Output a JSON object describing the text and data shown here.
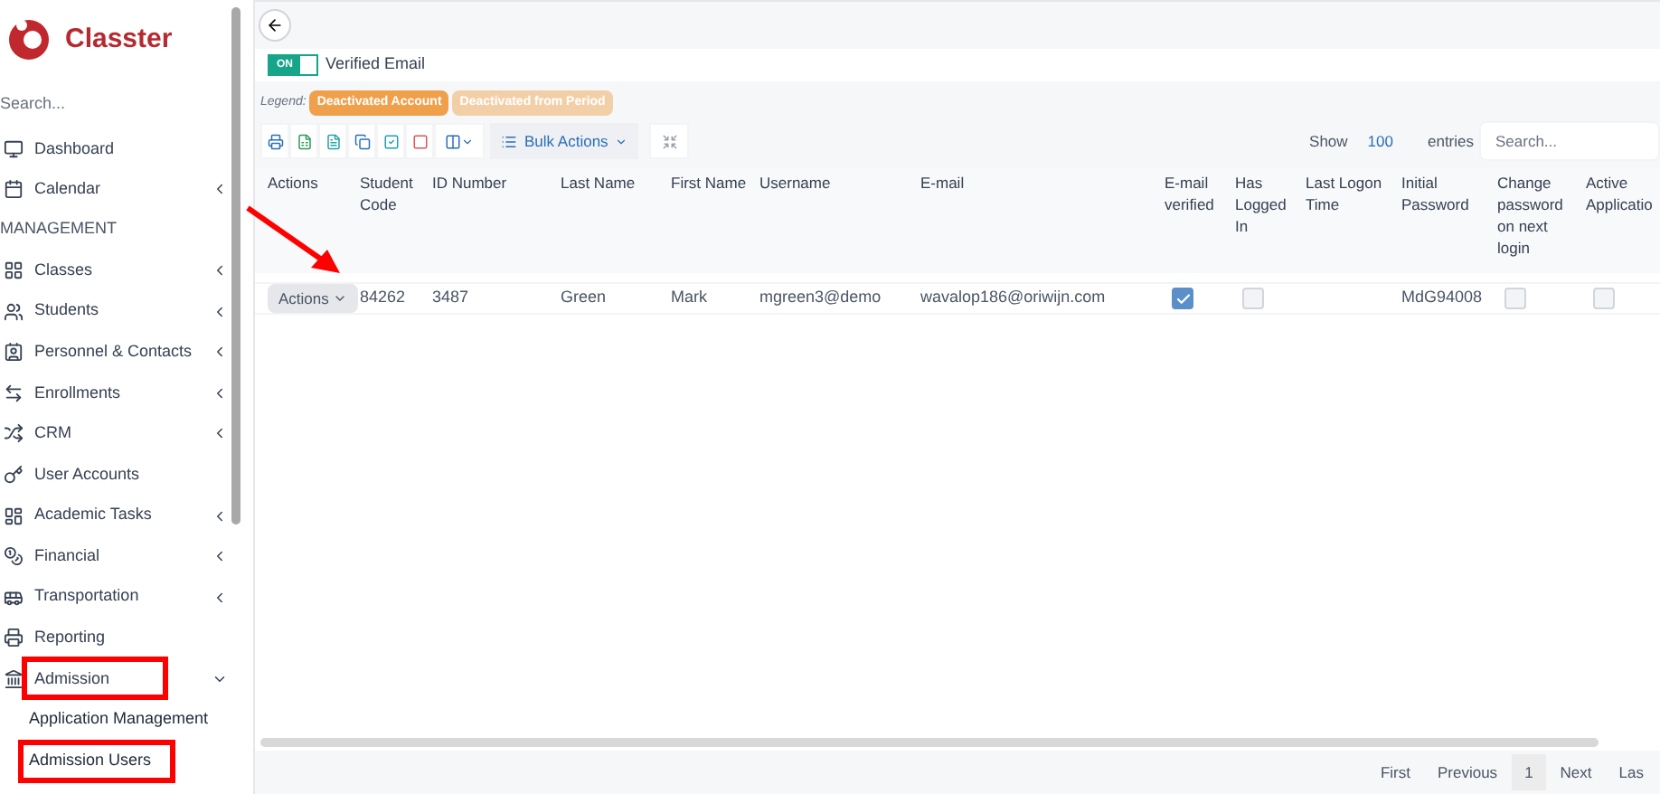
{
  "brand": "Classter",
  "sidebar": {
    "search_placeholder": "Search...",
    "items": [
      {
        "label": "Dashboard",
        "has_submenu": false
      },
      {
        "label": "Calendar",
        "has_submenu": true
      },
      {
        "kind": "section",
        "label": "MANAGEMENT"
      },
      {
        "label": "Classes",
        "has_submenu": true
      },
      {
        "label": "Students",
        "has_submenu": true
      },
      {
        "label": "Personnel & Contacts",
        "has_submenu": true
      },
      {
        "label": "Enrollments",
        "has_submenu": true
      },
      {
        "label": "CRM",
        "has_submenu": true
      },
      {
        "label": "User Accounts",
        "has_submenu": false
      },
      {
        "label": "Academic Tasks",
        "has_submenu": true
      },
      {
        "label": "Financial",
        "has_submenu": true
      },
      {
        "label": "Transportation",
        "has_submenu": true
      },
      {
        "label": "Reporting",
        "has_submenu": false
      },
      {
        "label": "Admission",
        "has_submenu": true,
        "expanded": true,
        "highlighted": true,
        "children": [
          {
            "label": "Application Management",
            "highlighted": false
          },
          {
            "label": "Admission Users",
            "highlighted": true
          }
        ]
      }
    ]
  },
  "filter": {
    "label": "Verified Email",
    "toggle_text": "ON",
    "on": true
  },
  "legend": {
    "label": "Legend:",
    "items": [
      {
        "label": "Deactivated Account",
        "color": "#f0a04b"
      },
      {
        "label": "Deactivated from Period",
        "color": "#f3cfa8"
      }
    ]
  },
  "toolbar": {
    "bulk_label": "Bulk Actions",
    "show_label": "Show",
    "page_size": "100",
    "entries_label": "entries",
    "search_placeholder": "Search..."
  },
  "table": {
    "columns": [
      "Actions",
      "Student Code",
      "ID Number",
      "Last Name",
      "First Name",
      "Username",
      "E-mail",
      "E-mail verified",
      "Has Logged In",
      "Last Logon Time",
      "Initial Password",
      "Change password on next login",
      "Active Applicatio"
    ],
    "rows": [
      [
        {
          "kind": "menu",
          "text": "Actions"
        },
        {
          "kind": "text",
          "text": "84262"
        },
        {
          "kind": "text",
          "text": "3487"
        },
        {
          "kind": "text",
          "text": "Green"
        },
        {
          "kind": "text",
          "text": "Mark"
        },
        {
          "kind": "text",
          "text": "mgreen3@demo"
        },
        {
          "kind": "text",
          "text": "wavalop186@oriwijn.com"
        },
        {
          "kind": "checkbox",
          "checked": true
        },
        {
          "kind": "checkbox",
          "checked": false
        },
        {
          "kind": "blank"
        },
        {
          "kind": "text",
          "text": "MdG94008"
        },
        {
          "kind": "checkbox",
          "checked": false
        },
        {
          "kind": "checkbox",
          "checked": false
        }
      ]
    ]
  },
  "pagination": [
    {
      "label": "First",
      "selected": false
    },
    {
      "label": "Previous",
      "selected": false
    },
    {
      "label": "1",
      "selected": true
    },
    {
      "label": "Next",
      "selected": false
    },
    {
      "label": "Las",
      "selected": false
    }
  ]
}
